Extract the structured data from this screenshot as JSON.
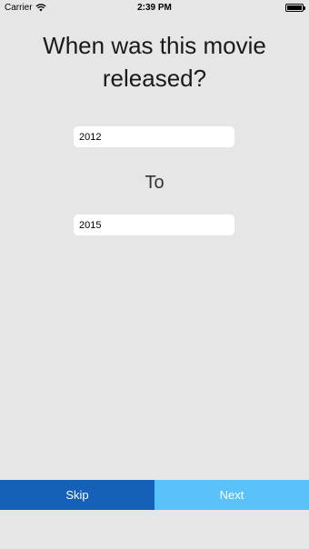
{
  "status_bar": {
    "carrier": "Carrier",
    "time": "2:39 PM",
    "wifi_icon": "wifi-icon",
    "battery_icon": "battery-icon"
  },
  "question": {
    "title": "When was this movie released?"
  },
  "range": {
    "from_value": "2012",
    "to_label": "To",
    "to_value": "2015"
  },
  "actions": {
    "skip_label": "Skip",
    "next_label": "Next"
  },
  "colors": {
    "background": "#e6e6e6",
    "skip": "#1560b8",
    "next": "#5ac2fa"
  }
}
